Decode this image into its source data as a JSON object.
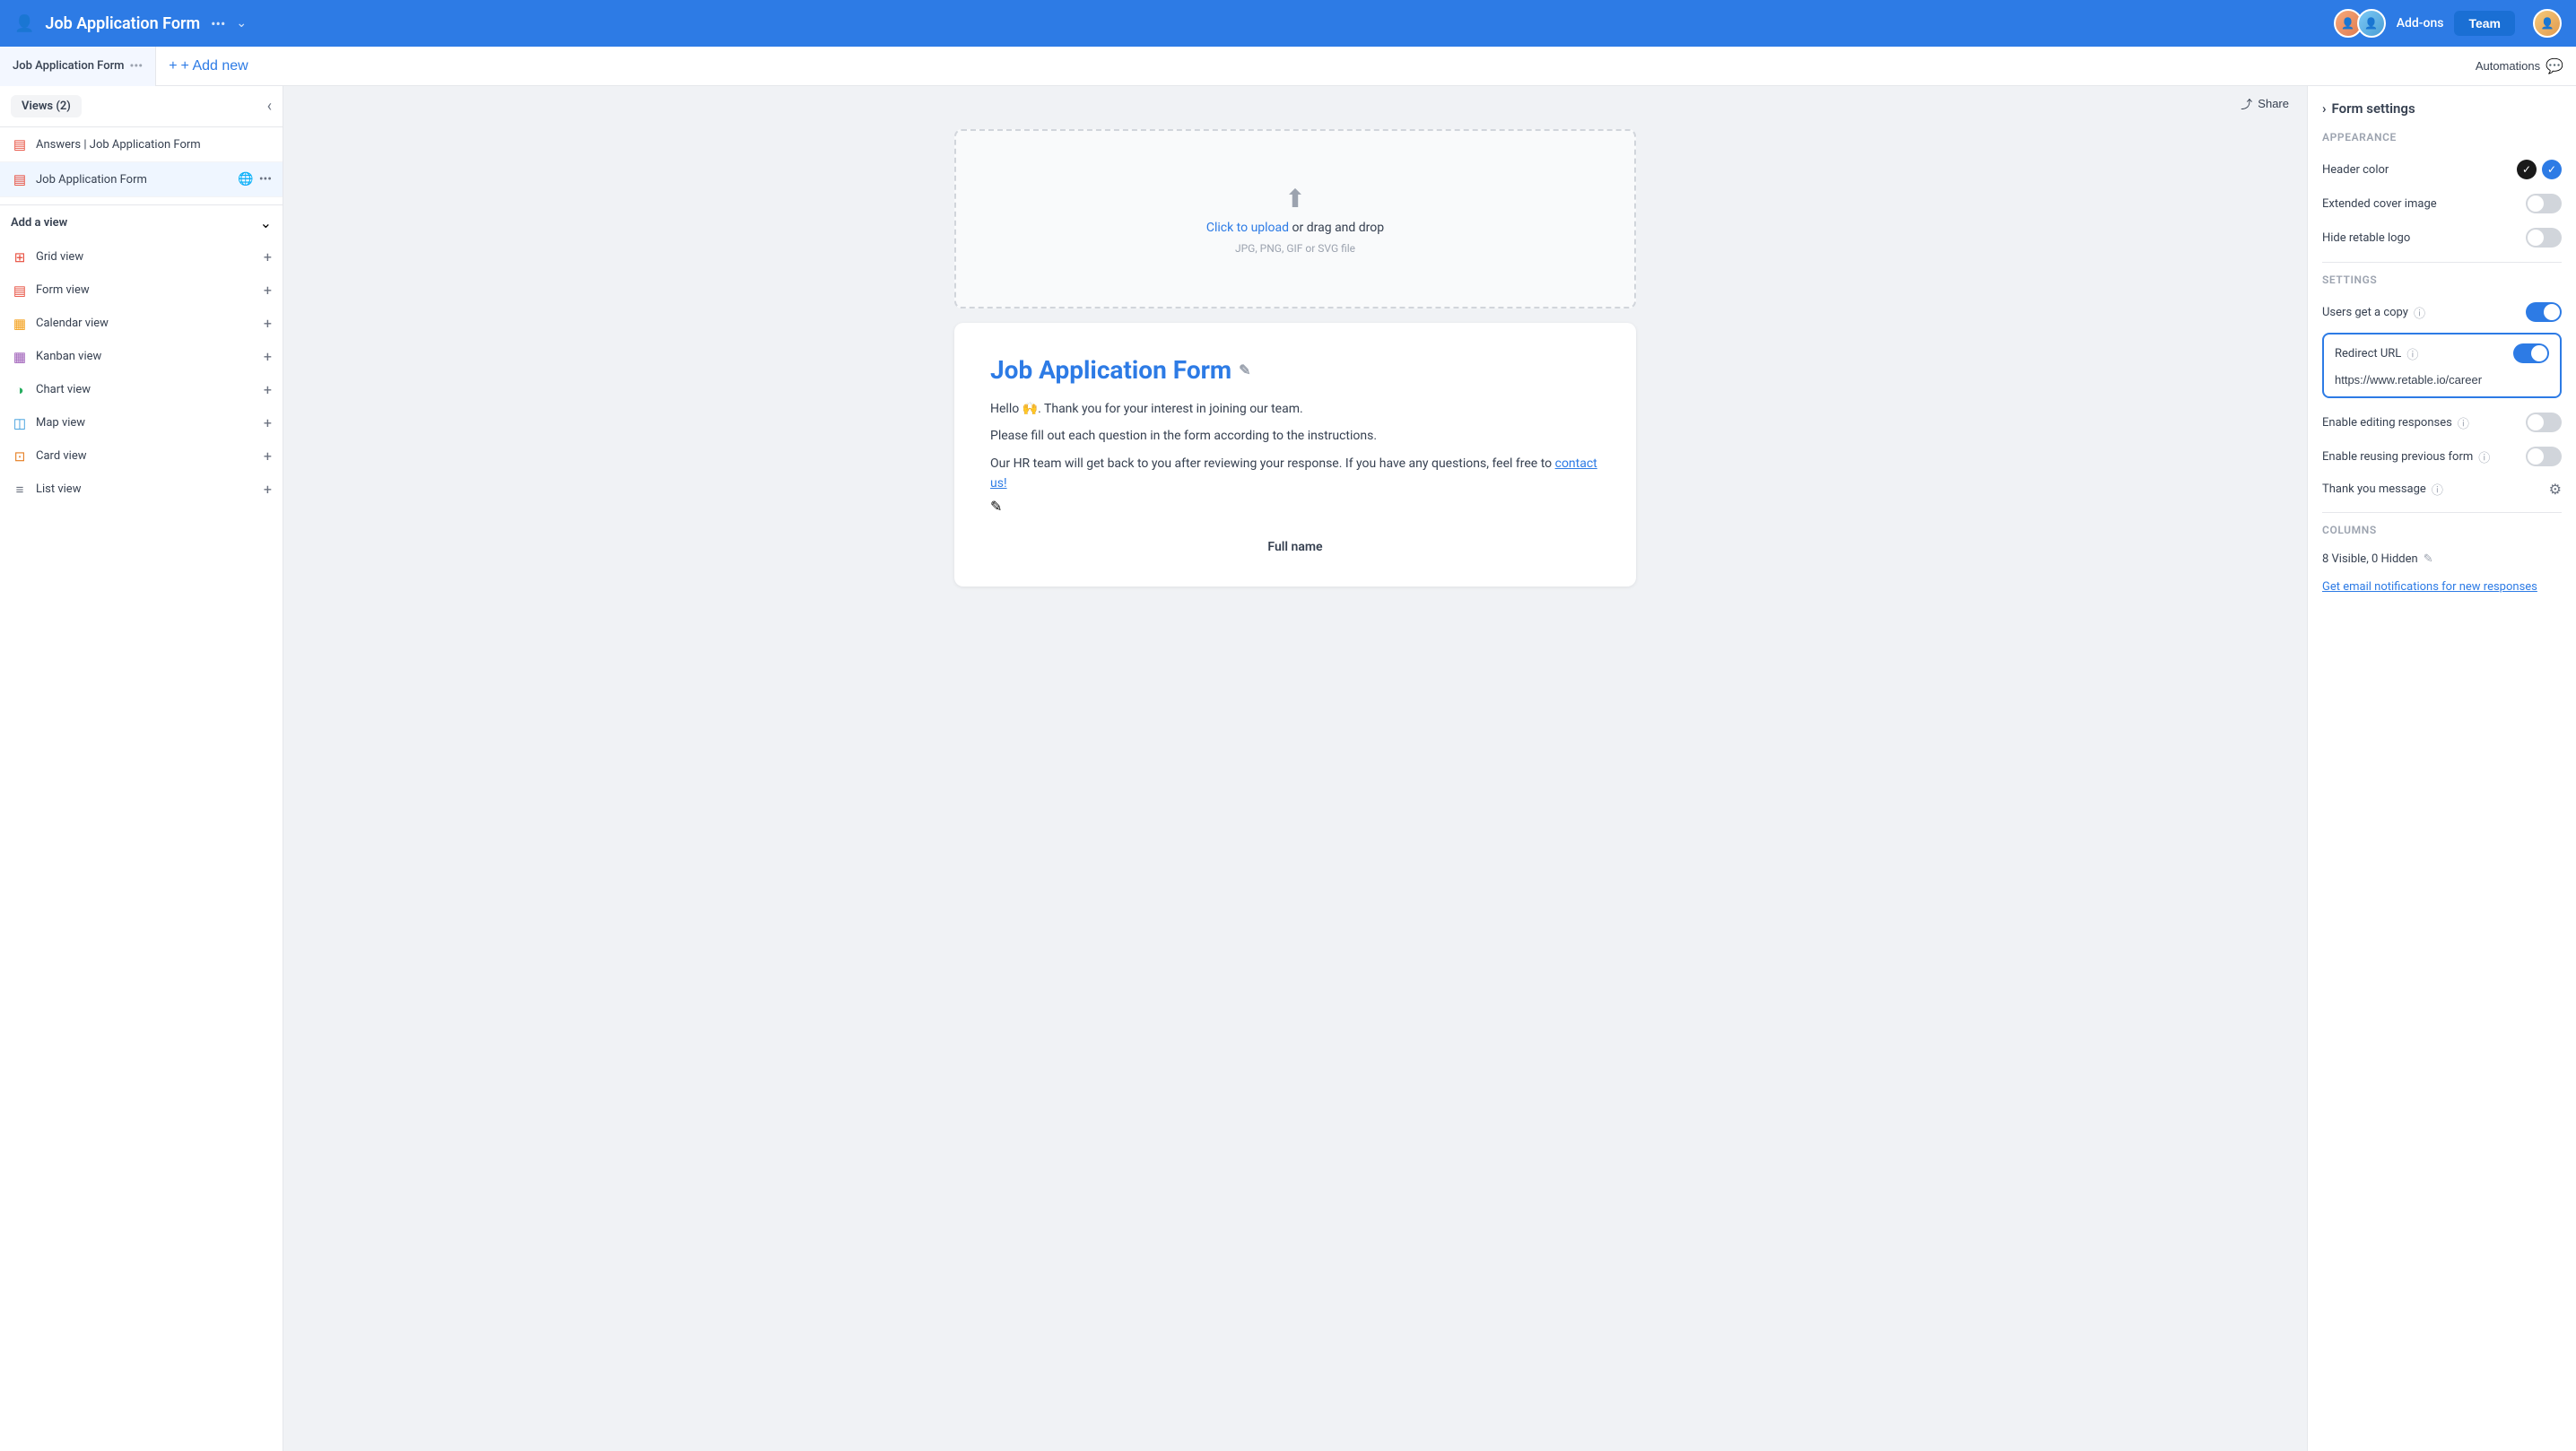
{
  "topBar": {
    "appIcon": "👤",
    "title": "Job Application Form",
    "dotsLabel": "•••",
    "chevronLabel": "⌄",
    "addonsLabel": "Add-ons",
    "teamLabel": "Team"
  },
  "tabBar": {
    "activeTab": "Job Application Form",
    "dotsLabel": "•••",
    "addNewLabel": "+ Add new",
    "automationsLabel": "Automations"
  },
  "sidebar": {
    "viewsCount": "Views (2)",
    "views": [
      {
        "id": "answers",
        "icon": "▤",
        "label": "Answers | Job Application Form",
        "iconColor": "#e74c3c",
        "active": false
      },
      {
        "id": "form",
        "icon": "▤",
        "label": "Job Application Form",
        "iconColor": "#e74c3c",
        "active": true
      }
    ],
    "addViewLabel": "Add a view",
    "viewTypes": [
      {
        "id": "grid",
        "icon": "⊞",
        "label": "Grid view",
        "iconColor": "#e74c3c"
      },
      {
        "id": "form",
        "icon": "▤",
        "label": "Form view",
        "iconColor": "#e74c3c"
      },
      {
        "id": "calendar",
        "icon": "▦",
        "label": "Calendar view",
        "iconColor": "#f39c12"
      },
      {
        "id": "kanban",
        "icon": "▦",
        "label": "Kanban view",
        "iconColor": "#9b59b6"
      },
      {
        "id": "chart",
        "icon": "◑",
        "label": "Chart view",
        "iconColor": "#27ae60"
      },
      {
        "id": "map",
        "icon": "◫",
        "label": "Map view",
        "iconColor": "#3498db"
      },
      {
        "id": "card",
        "icon": "⊡",
        "label": "Card view",
        "iconColor": "#e67e22"
      },
      {
        "id": "list",
        "icon": "≡",
        "label": "List view",
        "iconColor": "#6b7280"
      }
    ]
  },
  "shareBar": {
    "shareIcon": "⤴",
    "shareLabel": "Share"
  },
  "formPreview": {
    "uploadHint": "Click to upload or drag and drop",
    "uploadFormat": "JPG, PNG, GIF or SVG file",
    "formTitle": "Job Application Form",
    "editTitleIcon": "✎",
    "description1": "Hello 🙌. Thank you for your interest in joining our team.",
    "description2": "Please fill out each question in the form according to the instructions.",
    "description3": "Our HR team will get back to you after reviewing your response. If you have any questions, feel free to",
    "contactLink": "contact us!",
    "fieldLabel": "Full name"
  },
  "rightPanel": {
    "sectionTitle": "Form settings",
    "chevronIcon": "›",
    "appearance": {
      "groupLabel": "Appearance",
      "headerColorLabel": "Header color",
      "headerColors": [
        {
          "id": "black",
          "color": "#1a1a1a",
          "selected": true
        },
        {
          "id": "blue",
          "color": "#2d7be5",
          "selected": true
        }
      ],
      "extendedCoverLabel": "Extended cover image",
      "extendedCoverOn": false,
      "hideLogoLabel": "Hide retable logo",
      "hideLogoOn": false
    },
    "settings": {
      "groupLabel": "Settings",
      "usersCopyLabel": "Users get a copy",
      "usersCopyInfo": "ℹ",
      "usersCopyOn": true,
      "redirectUrlLabel": "Redirect URL",
      "redirectUrlInfo": "ℹ",
      "redirectUrlOn": true,
      "redirectUrlValue": "https://www.retable.io/career",
      "redirectUrlPlaceholder": "https://www.retable.io/career",
      "editingResponsesLabel": "Enable editing responses",
      "editingResponsesInfo": "ℹ",
      "editingResponsesOn": false,
      "reusingFormLabel": "Enable reusing previous form",
      "reusingFormInfo": "ℹ",
      "reusingFormOn": false,
      "thankYouLabel": "Thank you message",
      "thankYouInfo": "ℹ",
      "gearIcon": "⚙"
    },
    "columns": {
      "groupLabel": "Columns",
      "visibleCount": "8 Visible, 0 Hidden",
      "editIcon": "✎"
    },
    "emailNotification": {
      "label": "Get email notifications for new responses"
    }
  }
}
